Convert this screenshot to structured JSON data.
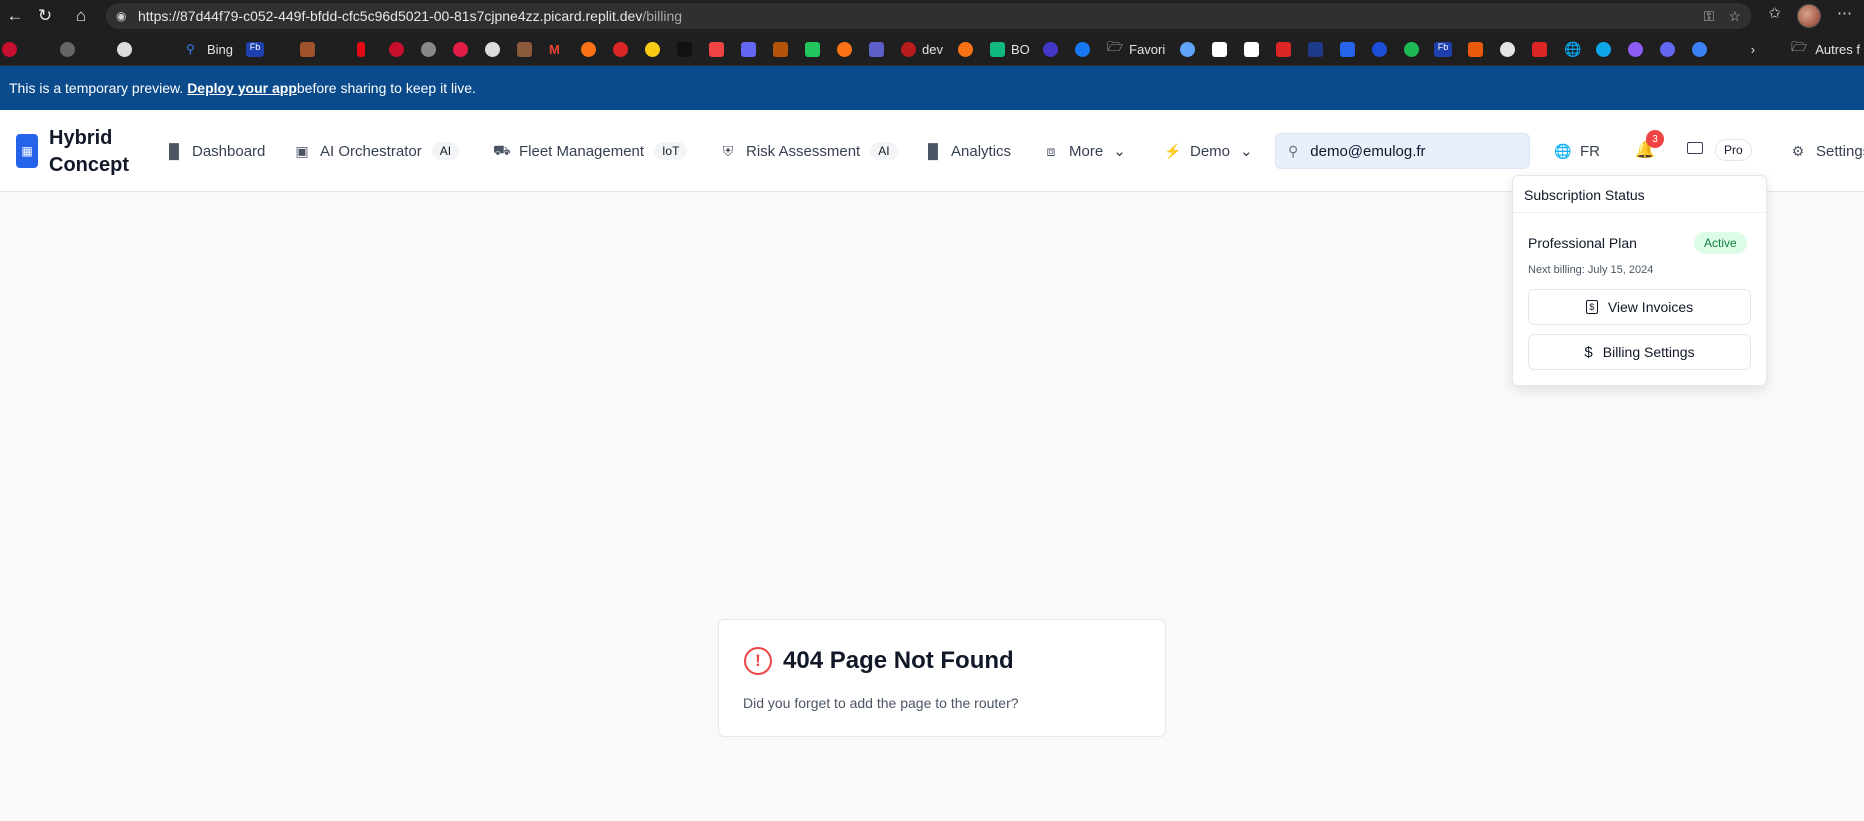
{
  "browser": {
    "url_main": "https://87d44f79-c052-449f-bfdd-cfc5c96d5021-00-81s7cjpne4zz.picard.replit.dev",
    "url_path": "/billing",
    "bookmarks": {
      "bing": "Bing",
      "fb1": "Fb",
      "dev": "dev",
      "bo": "BO",
      "favori": "Favori",
      "fb2": "Fb",
      "autres": "Autres f"
    }
  },
  "banner": {
    "text_before": "This is a temporary preview. ",
    "link": "Deploy your app",
    "text_after": " before sharing to keep it live."
  },
  "header": {
    "logo_line1": "Hybrid",
    "logo_line2": "Concept",
    "nav": {
      "dashboard": "Dashboard",
      "ai_orchestrator": "AI Orchestrator",
      "ai_orchestrator_badge": "AI",
      "fleet": "Fleet Management",
      "fleet_badge": "IoT",
      "risk": "Risk Assessment",
      "risk_badge": "AI",
      "analytics": "Analytics",
      "more": "More",
      "demo": "Demo"
    },
    "search_value": "demo@emulog.fr",
    "language": "FR",
    "notification_count": "3",
    "plan_badge": "Pro",
    "settings": "Settings"
  },
  "subscription": {
    "title": "Subscription Status",
    "plan": "Professional Plan",
    "status": "Active",
    "next_billing": "Next billing: July 15, 2024",
    "view_invoices": "View Invoices",
    "billing_settings": "Billing Settings"
  },
  "not_found": {
    "title": "404 Page Not Found",
    "message": "Did you forget to add the page to the router?"
  },
  "colors": {
    "banner": "#0b4a8b",
    "brand": "#2563eb",
    "error": "#ef4444",
    "active": "#15803d"
  }
}
